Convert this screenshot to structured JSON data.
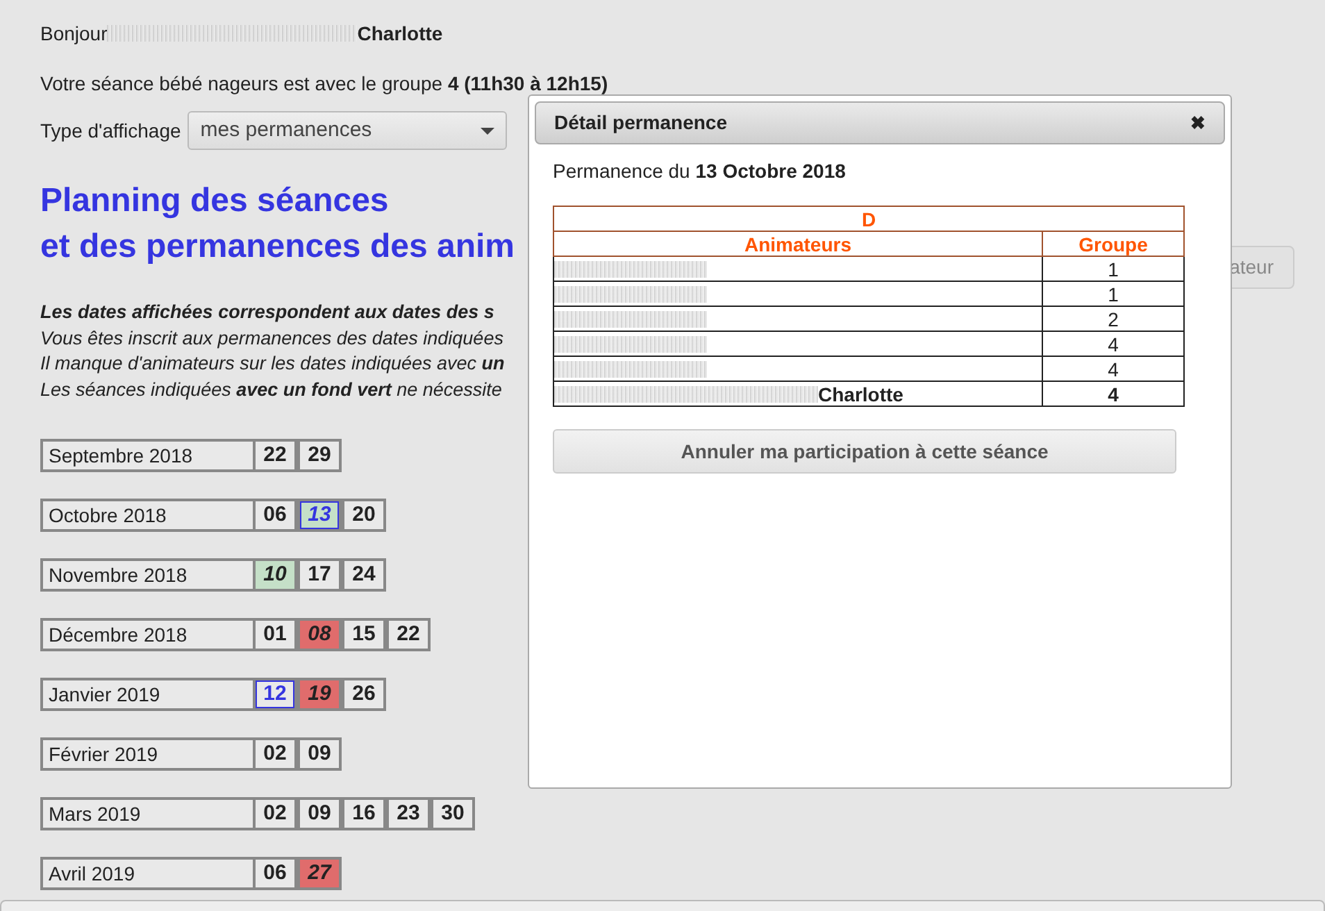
{
  "greeting": {
    "label": "Bonjour",
    "name": "Charlotte"
  },
  "session_line": "Votre séance bébé nageurs est avec le groupe **4 (11h30 à 12h15)**",
  "display_type": {
    "label": "Type d'affichage",
    "value": "mes permanences"
  },
  "heading": [
    "Planning des séances",
    "et des permanences des anim"
  ],
  "background_button": "ateur",
  "legend": [
    {
      "kind": "intro",
      "text": "Les dates affichées correspondent aux dates des s"
    },
    {
      "kind": "mine",
      "text": "Vous êtes inscrit aux permanences des dates indiquées"
    },
    {
      "kind": "missing",
      "text": "Il manque d'animateurs sur les dates indiquées avec **un**"
    },
    {
      "kind": "ok",
      "text": "Les séances indiquées **avec un fond vert** ne nécessite"
    }
  ],
  "months": [
    {
      "label": "Septembre 2018",
      "days": [
        {
          "day": "22",
          "full": false,
          "short": false,
          "mine": false
        },
        {
          "day": "29",
          "full": false,
          "short": false,
          "mine": false
        }
      ]
    },
    {
      "label": "Octobre 2018",
      "days": [
        {
          "day": "06",
          "full": false,
          "short": false,
          "mine": false
        },
        {
          "day": "13",
          "full": true,
          "short": false,
          "mine": true
        },
        {
          "day": "20",
          "full": false,
          "short": false,
          "mine": false
        }
      ]
    },
    {
      "label": "Novembre 2018",
      "days": [
        {
          "day": "10",
          "full": true,
          "short": false,
          "mine": false
        },
        {
          "day": "17",
          "full": false,
          "short": false,
          "mine": false
        },
        {
          "day": "24",
          "full": false,
          "short": false,
          "mine": false
        }
      ]
    },
    {
      "label": "Décembre 2018",
      "days": [
        {
          "day": "01",
          "full": false,
          "short": false,
          "mine": false
        },
        {
          "day": "08",
          "full": false,
          "short": true,
          "mine": false
        },
        {
          "day": "15",
          "full": false,
          "short": false,
          "mine": false
        },
        {
          "day": "22",
          "full": false,
          "short": false,
          "mine": false
        }
      ]
    },
    {
      "label": "Janvier 2019",
      "days": [
        {
          "day": "12",
          "full": false,
          "short": false,
          "mine": true
        },
        {
          "day": "19",
          "full": false,
          "short": true,
          "mine": false
        },
        {
          "day": "26",
          "full": false,
          "short": false,
          "mine": false
        }
      ]
    },
    {
      "label": "Février 2019",
      "days": [
        {
          "day": "02",
          "full": false,
          "short": false,
          "mine": false
        },
        {
          "day": "09",
          "full": false,
          "short": false,
          "mine": false
        }
      ]
    },
    {
      "label": "Mars 2019",
      "days": [
        {
          "day": "02",
          "full": false,
          "short": false,
          "mine": false
        },
        {
          "day": "09",
          "full": false,
          "short": false,
          "mine": false
        },
        {
          "day": "16",
          "full": false,
          "short": false,
          "mine": false
        },
        {
          "day": "23",
          "full": false,
          "short": false,
          "mine": false
        },
        {
          "day": "30",
          "full": false,
          "short": false,
          "mine": false
        }
      ]
    },
    {
      "label": "Avril 2019",
      "days": [
        {
          "day": "06",
          "full": false,
          "short": false,
          "mine": false
        },
        {
          "day": "27",
          "full": false,
          "short": true,
          "mine": false
        }
      ]
    }
  ],
  "dialog": {
    "title": "Détail permanence",
    "close": "✖",
    "subtitle": "Permanence du **13 Octobre 2018**",
    "table": {
      "caption": "D",
      "columns": [
        "Animateurs",
        "Groupe"
      ],
      "rows": [
        {
          "group": "1"
        },
        {
          "group": "1"
        },
        {
          "group": "2"
        },
        {
          "group": "4"
        },
        {
          "group": "4"
        },
        {
          "name": "Charlotte",
          "group": "4"
        }
      ]
    },
    "button": "Annuler ma participation à cette séance"
  }
}
